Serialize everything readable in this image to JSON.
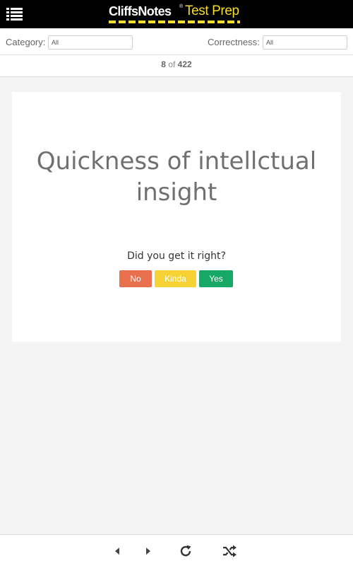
{
  "header": {
    "logo_brand": "CliffsNotes",
    "logo_registered": "®",
    "logo_sub": "Test Prep",
    "accent_color": "#f6dd2a",
    "menu_icon": "list-menu-icon"
  },
  "filters": {
    "category_label": "Category:",
    "category_value": "All",
    "correctness_label": "Correctness:",
    "correctness_value": "All"
  },
  "counter": {
    "current": "8",
    "of": "of",
    "total": "422"
  },
  "card": {
    "term": "Quickness of intellctual insight",
    "question": "Did you get it right?",
    "buttons": {
      "no": "No",
      "kinda": "Kinda",
      "yes": "Yes"
    },
    "colors": {
      "no": "#e8704f",
      "kinda": "#f7d235",
      "yes": "#16a864"
    }
  },
  "bottom_nav": {
    "icons": [
      "previous-icon",
      "next-icon",
      "refresh-icon",
      "shuffle-icon"
    ]
  }
}
